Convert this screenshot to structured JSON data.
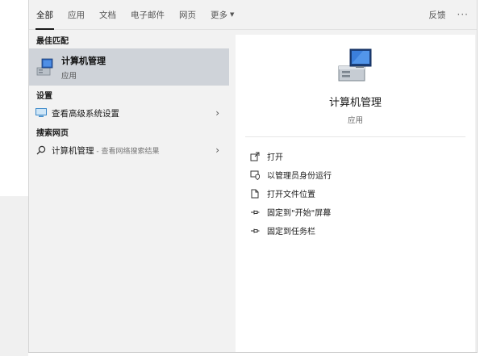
{
  "tabs": [
    {
      "label": "全部",
      "active": true
    },
    {
      "label": "应用",
      "active": false
    },
    {
      "label": "文档",
      "active": false
    },
    {
      "label": "电子邮件",
      "active": false
    },
    {
      "label": "网页",
      "active": false
    },
    {
      "label": "更多",
      "active": false
    }
  ],
  "topbar": {
    "feedback": "反馈",
    "more_menu": "···"
  },
  "sections": {
    "best_match": "最佳匹配",
    "settings": "设置",
    "web_search": "搜索网页"
  },
  "best_match": {
    "name": "计算机管理",
    "type": "应用",
    "icon": "computer-management-icon"
  },
  "settings_item": {
    "label": "查看高级系统设置",
    "icon": "monitor-settings-icon"
  },
  "web_item": {
    "label": "计算机管理",
    "suffix": " - 查看网络搜索结果",
    "icon": "search-icon"
  },
  "detail": {
    "title": "计算机管理",
    "type": "应用",
    "actions": [
      {
        "label": "打开",
        "icon": "open-icon"
      },
      {
        "label": "以管理员身份运行",
        "icon": "run-as-admin-icon"
      },
      {
        "label": "打开文件位置",
        "icon": "file-location-icon"
      },
      {
        "label": "固定到\"开始\"屏幕",
        "icon": "pin-start-icon"
      },
      {
        "label": "固定到任务栏",
        "icon": "pin-taskbar-icon"
      }
    ]
  },
  "colors": {
    "selected_bg": "#cfd3d9",
    "panel_bg": "#f2f2f2",
    "detail_bg": "#ffffff"
  }
}
